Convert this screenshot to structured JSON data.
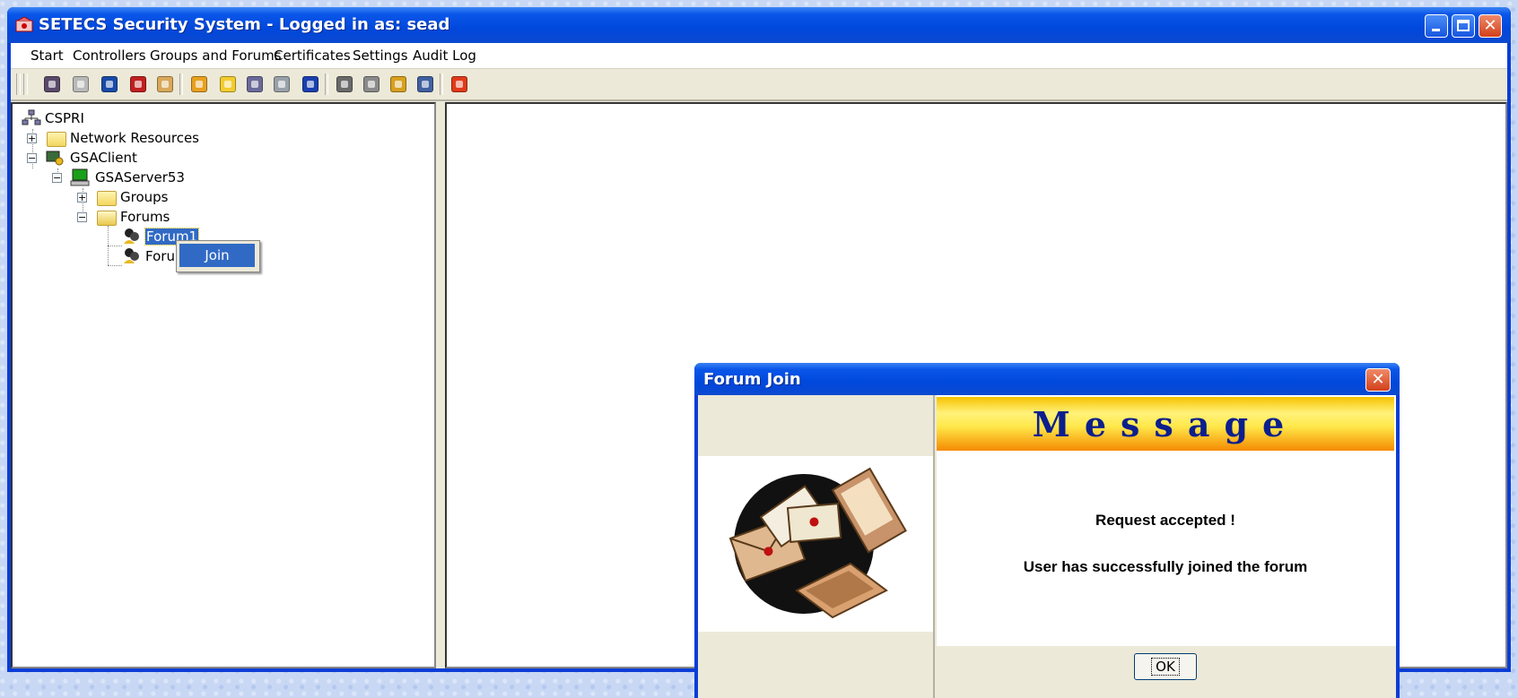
{
  "window": {
    "title": "SETECS Security System - Logged in as: sead"
  },
  "menu": [
    "Start",
    "Controllers",
    "Groups and Forums",
    "Certificates",
    "Settings",
    "Audit Log"
  ],
  "toolbar_icons": [
    "user-certificate-icon",
    "directory-icon",
    "monitor-icon",
    "monitor-alert-icon",
    "card-icon",
    "users-group-icon",
    "folder-forum-icon",
    "network-icon",
    "chart-icon",
    "refresh-icon",
    "list-icon",
    "printer-icon",
    "display-icon",
    "book-icon",
    "power-icon"
  ],
  "tree": {
    "root": "CSPRI",
    "network_resources": "Network Resources",
    "client": "GSAClient",
    "server": "GSAServer53",
    "groups": "Groups",
    "forums": "Forums",
    "forum1": "Forum1",
    "forum2": "Forum"
  },
  "context_menu": {
    "join": "Join"
  },
  "dialog": {
    "title": "Forum Join",
    "banner": "Message",
    "line1": "Request accepted !",
    "line2": "User has successfully joined the forum",
    "ok": "OK"
  },
  "colors": {
    "title_blue": "#0a56e8",
    "selection": "#316ac5",
    "banner_text": "#0c1f8c"
  }
}
